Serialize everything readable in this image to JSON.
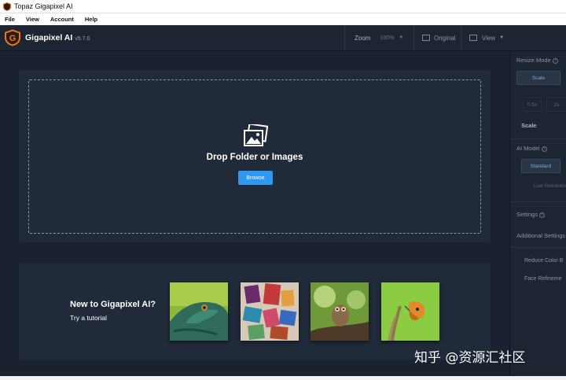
{
  "window": {
    "title": "Topaz Gigapixel AI"
  },
  "menu": {
    "items": [
      {
        "label": "File",
        "key": "F"
      },
      {
        "label": "View",
        "key": "V"
      },
      {
        "label": "Account",
        "key": "A"
      },
      {
        "label": "Help",
        "key": "H"
      }
    ]
  },
  "toolbar": {
    "brand": "Gigapixel AI",
    "version": "v5.7.0",
    "zoom_label": "Zoom",
    "zoom_value": "100%",
    "original_label": "Original",
    "view_label": "View"
  },
  "drop": {
    "title": "Drop Folder or Images",
    "browse_label": "Browse"
  },
  "tutorial": {
    "title": "New to Gigapixel AI?",
    "subtitle": "Try a tutorial",
    "thumbnails": [
      "lizard",
      "wood-blocks",
      "owl",
      "butterfly"
    ]
  },
  "sidebar": {
    "resize_mode": "Resize Mode",
    "scale_button": "Scale",
    "scale_options": [
      "0.5x",
      "2x"
    ],
    "scale_label": "Scale",
    "ai_model": "AI Model",
    "standard_button": "Standard",
    "low_resolution": "Low Resolutio",
    "settings": "Settings",
    "additional_settings": "Additional Settings",
    "reduce_color": "Reduce Color B",
    "face_refinement": "Face Refineme"
  },
  "watermark": "知乎 @资源汇社区",
  "colors": {
    "accent": "#2f98f0",
    "background": "#1a2230",
    "panel": "#202a39",
    "logo_orange": "#f07a1e"
  }
}
